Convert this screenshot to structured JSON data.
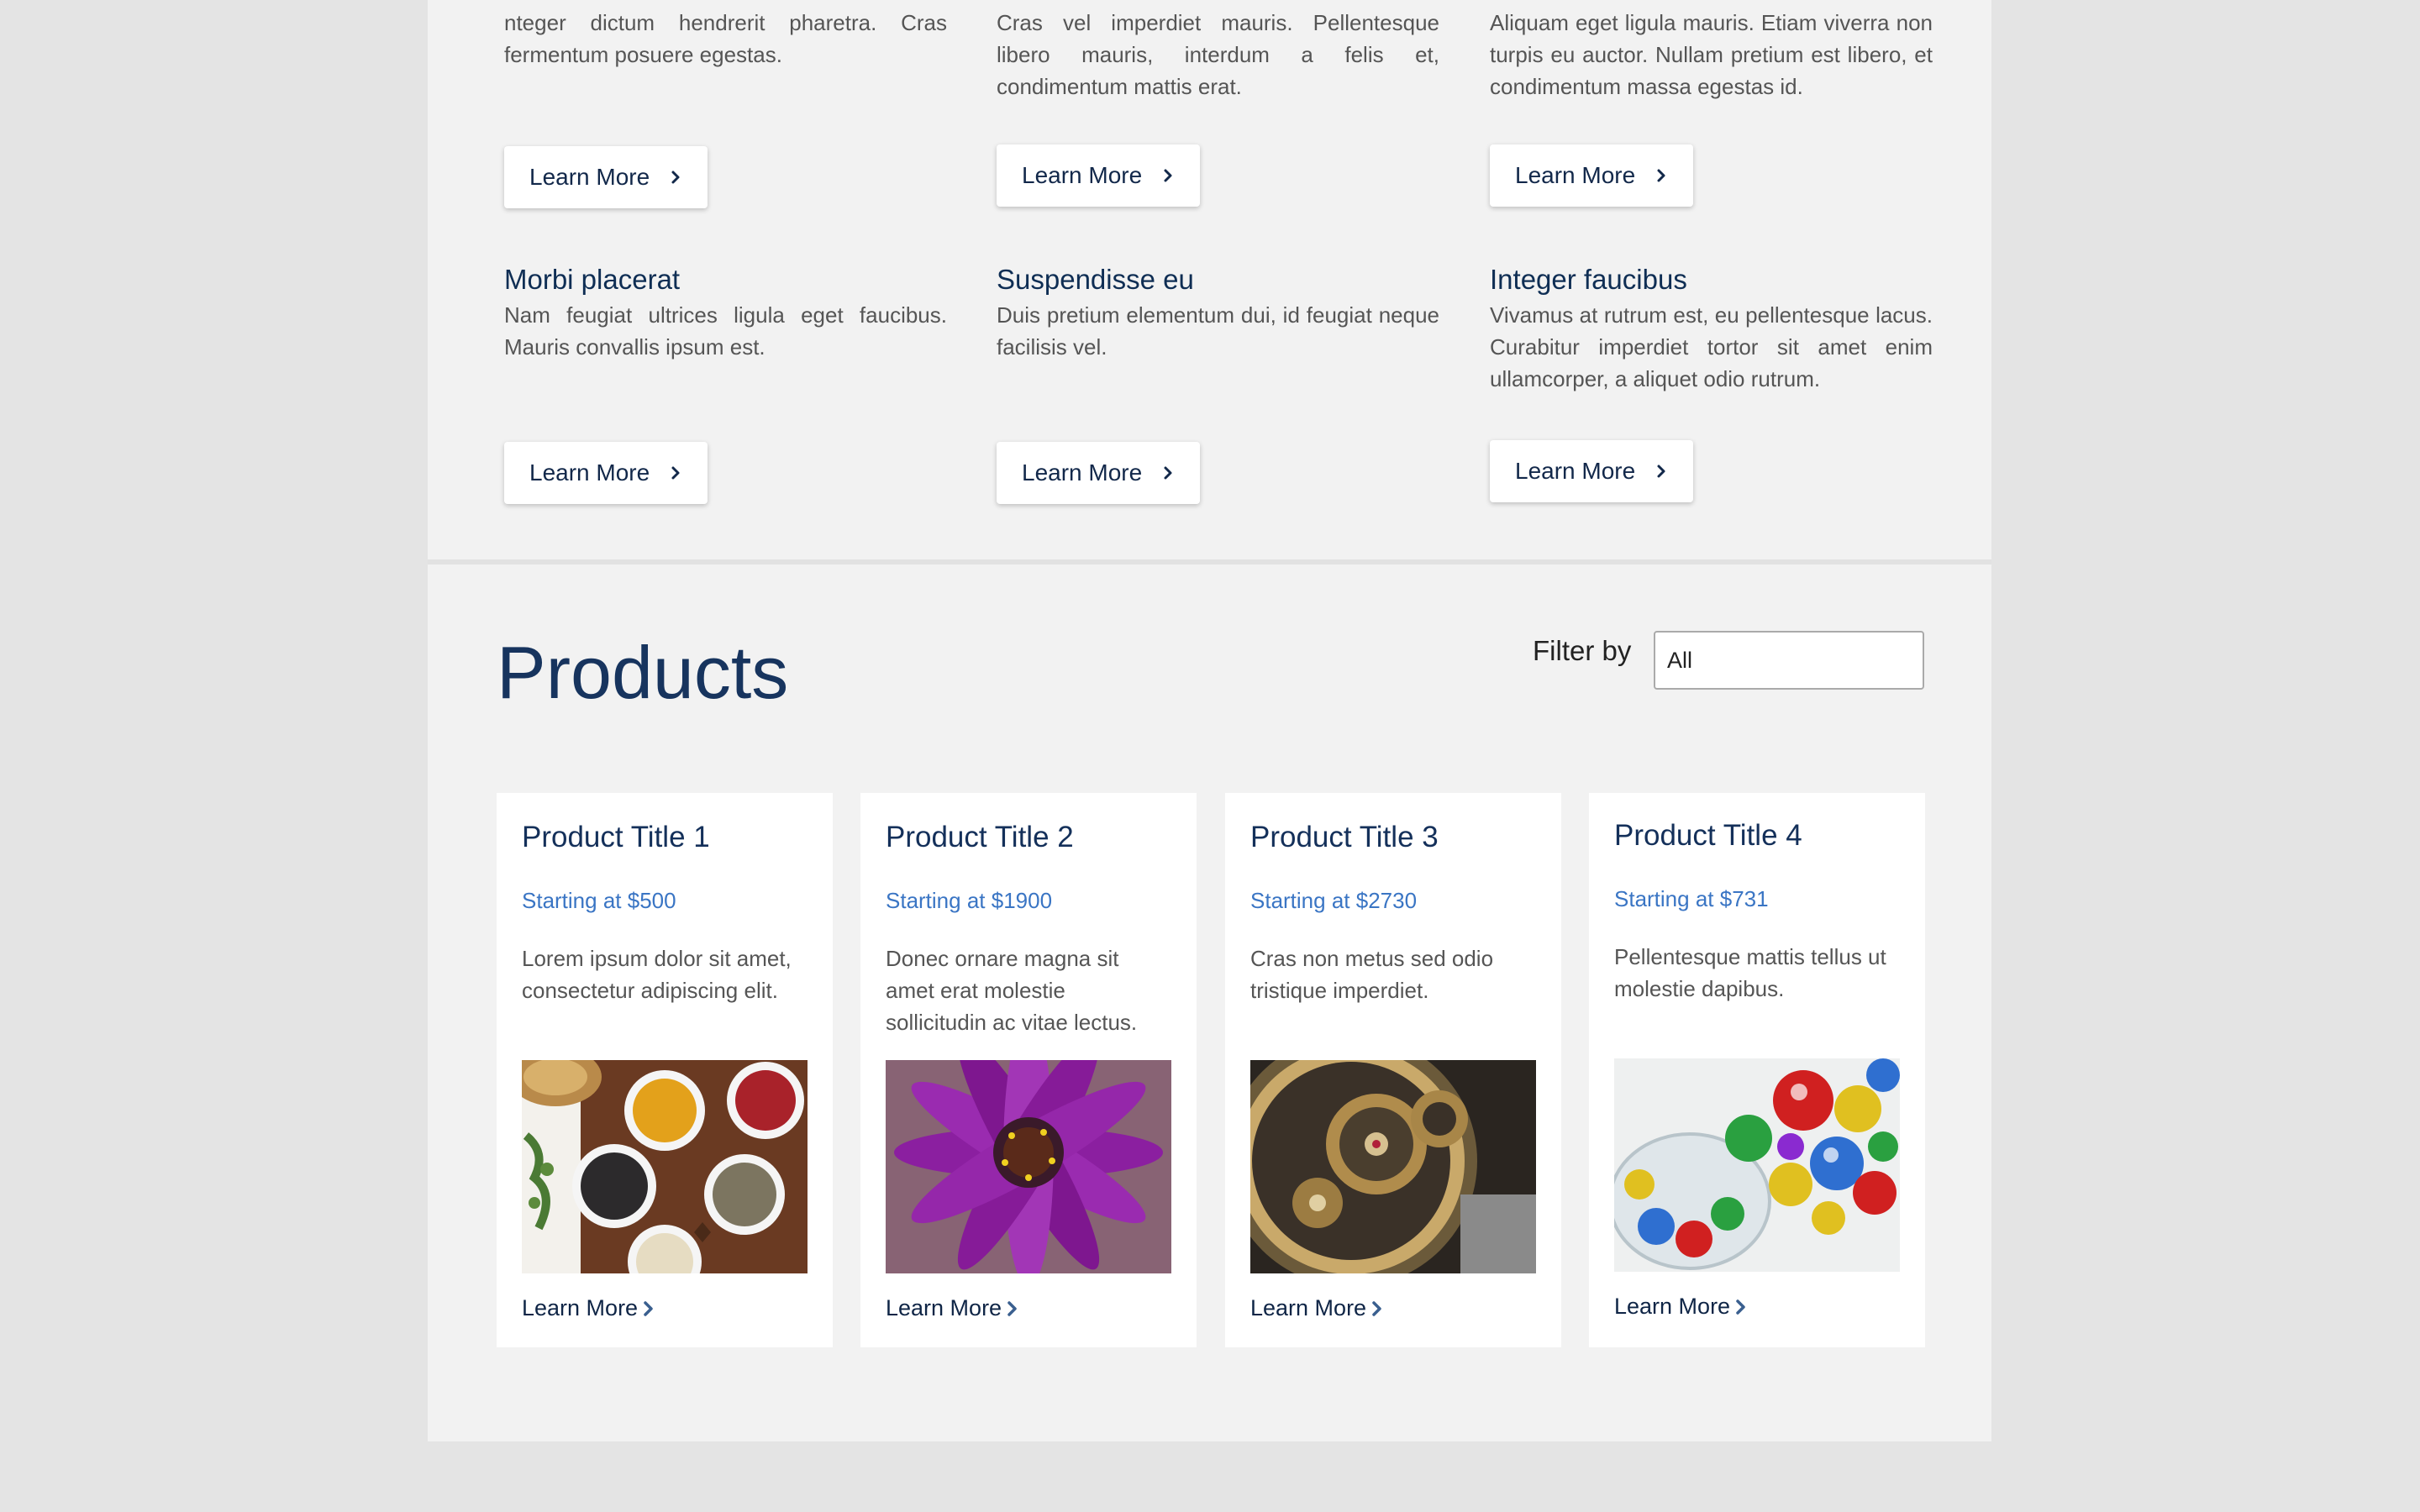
{
  "features": [
    {
      "title": "",
      "text": "nteger dictum hendrerit pharetra. Cras fermentum posuere egestas.",
      "button": "Learn More"
    },
    {
      "title": "",
      "text": "Cras vel imperdiet mauris. Pellentesque libero mauris, interdum a felis et, condimentum mattis erat.",
      "button": "Learn More"
    },
    {
      "title": "",
      "text": "Aliquam eget ligula mauris. Etiam viverra non turpis eu auctor. Nullam pretium est libero, et condimentum massa egestas id.",
      "button": "Learn More"
    },
    {
      "title": "Morbi placerat",
      "text": "Nam feugiat ultrices ligula eget faucibus. Mauris convallis ipsum est.",
      "button": "Learn More"
    },
    {
      "title": "Suspendisse eu",
      "text": "Duis pretium elementum dui, id feugiat neque facilisis vel.",
      "button": "Learn More"
    },
    {
      "title": "Integer faucibus",
      "text": "Vivamus at rutrum est, eu pellentesque lacus. Curabitur imperdiet tortor sit amet enim ullamcorper, a aliquet odio rutrum.",
      "button": "Learn More"
    }
  ],
  "products": {
    "heading": "Products",
    "filter_label": "Filter by",
    "filter_value": "All",
    "items": [
      {
        "title": "Product Title 1",
        "price": "Starting at $500",
        "description": "Lorem ipsum dolor sit amet, consectetur adipiscing elit.",
        "image": "spices-bowls-image",
        "link": "Learn More"
      },
      {
        "title": "Product Title 2",
        "price": "Starting at $1900",
        "description": "Donec ornare magna sit amet erat molestie sollicitudin ac vitae lectus.",
        "image": "purple-flower-image",
        "link": "Learn More"
      },
      {
        "title": "Product Title 3",
        "price": "Starting at $2730",
        "description": "Cras non metus sed odio tristique imperdiet.",
        "image": "watch-gears-image",
        "link": "Learn More"
      },
      {
        "title": "Product Title 4",
        "price": "Starting at $731",
        "description": "Pellentesque mattis tellus ut molestie dapibus.",
        "image": "glass-marbles-image",
        "link": "Learn More"
      }
    ]
  },
  "colors": {
    "heading": "#17345e",
    "price": "#3a75c4",
    "text": "#555555",
    "page_bg": "#f2f2f2",
    "outer_bg": "#e4e4e4"
  }
}
